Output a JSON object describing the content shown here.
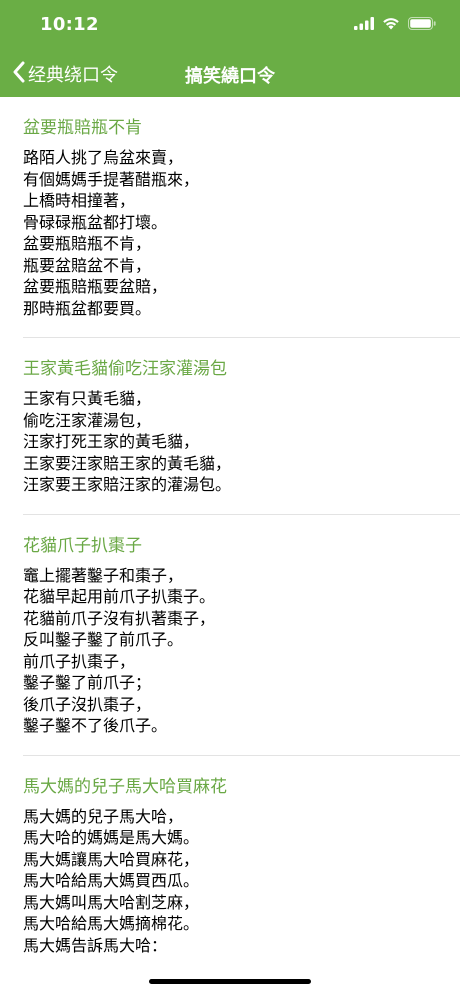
{
  "status": {
    "time": "10:12"
  },
  "nav": {
    "back_label": "经典绕口令",
    "title": "搞笑繞口令"
  },
  "items": [
    {
      "title": "盆要瓶賠瓶不肯",
      "text": "路陌人挑了烏盆來賣，\n有個媽媽手提著醋瓶來，\n上橋時相撞著，\n骨碌碌瓶盆都打壞。\n盆要瓶賠瓶不肯，\n瓶要盆賠盆不肯，\n盆要瓶賠瓶要盆賠，\n那時瓶盆都要買。"
    },
    {
      "title": "王家黃毛貓偷吃汪家灌湯包",
      "text": "王家有只黃毛貓，\n偷吃汪家灌湯包，\n汪家打死王家的黃毛貓，\n王家要汪家賠王家的黃毛貓，\n汪家要王家賠汪家的灌湯包。"
    },
    {
      "title": "花貓爪子扒棗子",
      "text": "竈上擺著鑿子和棗子，\n花貓早起用前爪子扒棗子。\n花貓前爪子沒有扒著棗子，\n反叫鑿子鑿了前爪子。\n前爪子扒棗子，\n鑿子鑿了前爪子；\n後爪子沒扒棗子，\n鑿子鑿不了後爪子。"
    },
    {
      "title": "馬大媽的兒子馬大哈買麻花",
      "text": "馬大媽的兒子馬大哈，\n馬大哈的媽媽是馬大媽。\n馬大媽讓馬大哈買麻花，\n馬大哈給馬大媽買西瓜。\n馬大媽叫馬大哈割芝麻，\n馬大哈給馬大媽摘棉花。\n馬大媽告訴馬大哈：\n以後不能再馬大哈；\n馬大哈不改馬大哈"
    }
  ]
}
